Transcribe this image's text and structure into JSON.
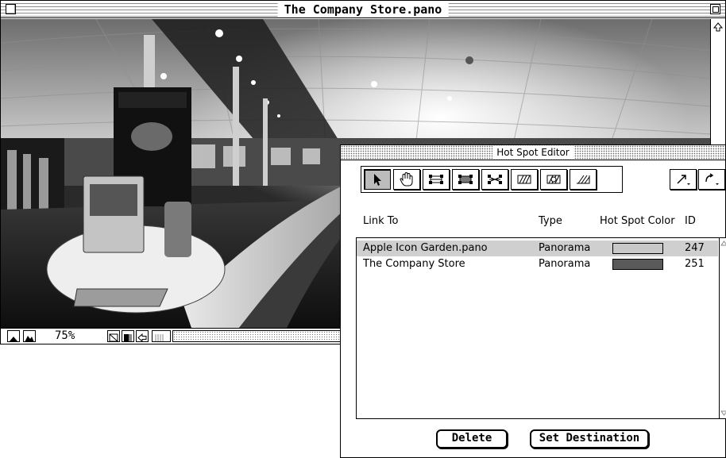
{
  "main_window": {
    "title": "The Company Store.pano",
    "zoom_level": "75%"
  },
  "hot_spot_editor": {
    "title": "Hot Spot Editor",
    "tools": [
      "arrow-select-icon",
      "hand-icon",
      "rectangle-hotspot-icon",
      "filled-rectangle-hotspot-icon",
      "shrink-rectangle-icon",
      "hatch-rectangle-icon",
      "hatch-oval-icon",
      "diagonal-hatch-icon"
    ],
    "selected_tool": "arrow-select-icon",
    "columns": {
      "link_to": "Link To",
      "type": "Type",
      "hot_spot_color": "Hot Spot Color",
      "id": "ID"
    },
    "rows": [
      {
        "link_to": "Apple Icon Garden.pano",
        "type": "Panorama",
        "color": "#c8c8c8",
        "id": "247",
        "selected": true
      },
      {
        "link_to": "The Company Store",
        "type": "Panorama",
        "color": "#5a5a5a",
        "id": "251",
        "selected": false
      }
    ],
    "buttons": {
      "delete": "Delete",
      "set_destination": "Set Destination"
    }
  }
}
